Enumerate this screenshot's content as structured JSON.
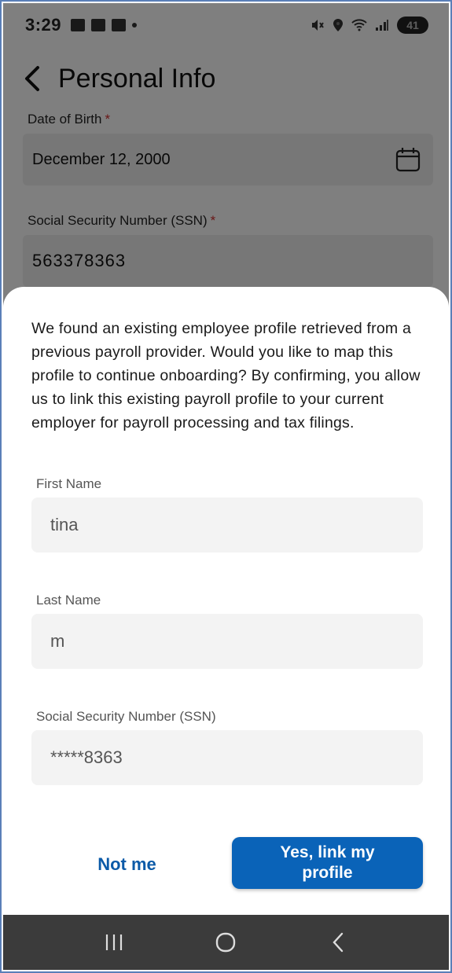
{
  "status_bar": {
    "time": "3:29",
    "battery": "41"
  },
  "header": {
    "title": "Personal Info"
  },
  "form": {
    "dob_label": "Date of Birth",
    "dob_value": "December 12, 2000",
    "ssn_label": "Social Security Number (SSN)",
    "ssn_value": "563378363",
    "required_mark": "*"
  },
  "sheet": {
    "message": "We found an existing employee profile retrieved from a previous payroll provider. Would you like to map this profile to continue onboarding? By confirming, you allow us to link this existing payroll profile to your current employer for payroll processing and tax filings.",
    "first_name_label": "First Name",
    "first_name_value": "tina",
    "last_name_label": "Last Name",
    "last_name_value": "m",
    "ssn_label": "Social Security Number (SSN)",
    "ssn_value": "*****8363",
    "not_me_label": "Not me",
    "confirm_label": "Yes, link my profile"
  },
  "colors": {
    "primary": "#0a63b8",
    "link": "#0b5aa8",
    "required": "#d32f2f",
    "navbar": "#3b3b3b"
  },
  "icons": {
    "back": "chevron-left-icon",
    "calendar": "calendar-icon",
    "nav_recents": "recents-icon",
    "nav_home": "home-icon",
    "nav_back": "back-icon"
  }
}
